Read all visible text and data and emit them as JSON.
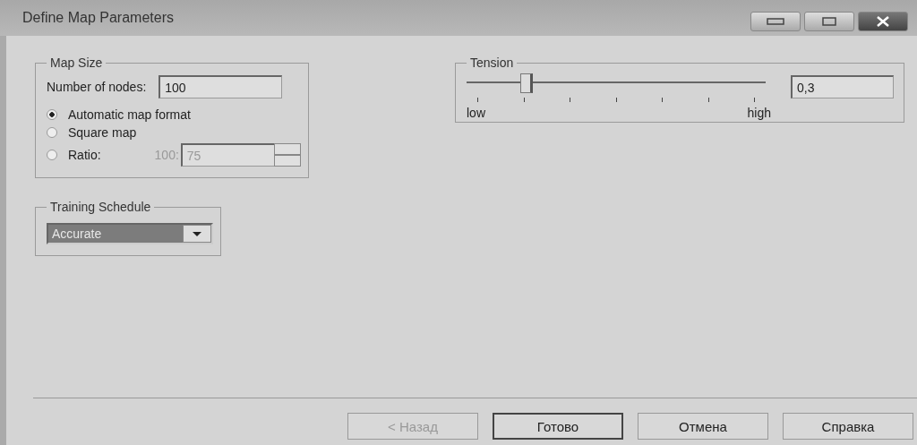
{
  "window": {
    "title": "Define Map Parameters"
  },
  "map_size": {
    "title": "Map Size",
    "nodes_label": "Number of nodes:",
    "nodes_value": "100",
    "options": [
      {
        "label": "Automatic map format",
        "selected": true
      },
      {
        "label": "Square map",
        "selected": false
      },
      {
        "label": "Ratio:",
        "selected": false
      }
    ],
    "ratio_prefix": "100:",
    "ratio_value": "75",
    "ratio_disabled": true
  },
  "training_schedule": {
    "title": "Training Schedule",
    "value": "Accurate"
  },
  "tension": {
    "title": "Tension",
    "level": 0.17,
    "value": "0,3",
    "low_label": "low",
    "high_label": "high"
  },
  "buttons": [
    {
      "label": "< Назад",
      "disabled": true,
      "default": false
    },
    {
      "label": "Готово",
      "disabled": false,
      "default": true
    },
    {
      "label": "Отмена",
      "disabled": false,
      "default": false
    },
    {
      "label": "Справка",
      "disabled": false,
      "default": false
    }
  ]
}
